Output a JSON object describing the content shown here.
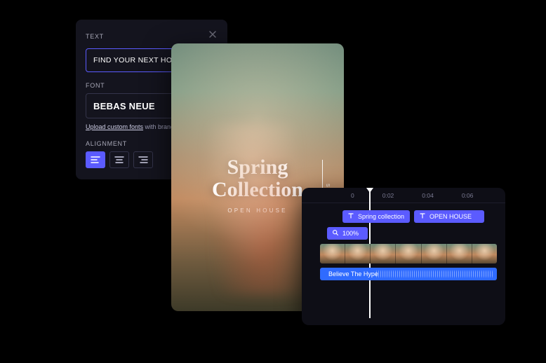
{
  "text_panel": {
    "section_text": "TEXT",
    "text_value": "FIND YOUR NEXT HOME",
    "section_font": "FONT",
    "font_name": "BEBAS NEUE",
    "upload_link": "Upload custom fonts",
    "upload_rest": " with brand kit",
    "section_align": "ALIGNMENT"
  },
  "preview": {
    "title_line1": "Spring",
    "title_line2": "Collection",
    "subtitle": "OPEN HOUSE",
    "side_word": "SALE"
  },
  "timeline": {
    "ticks": [
      "0",
      "0:02",
      "0:04",
      "0:06"
    ],
    "text_clip_1": "Spring collection",
    "text_clip_2": "OPEN HOUSE",
    "zoom_clip": "100%",
    "audio_clip": "Believe The Hype"
  }
}
